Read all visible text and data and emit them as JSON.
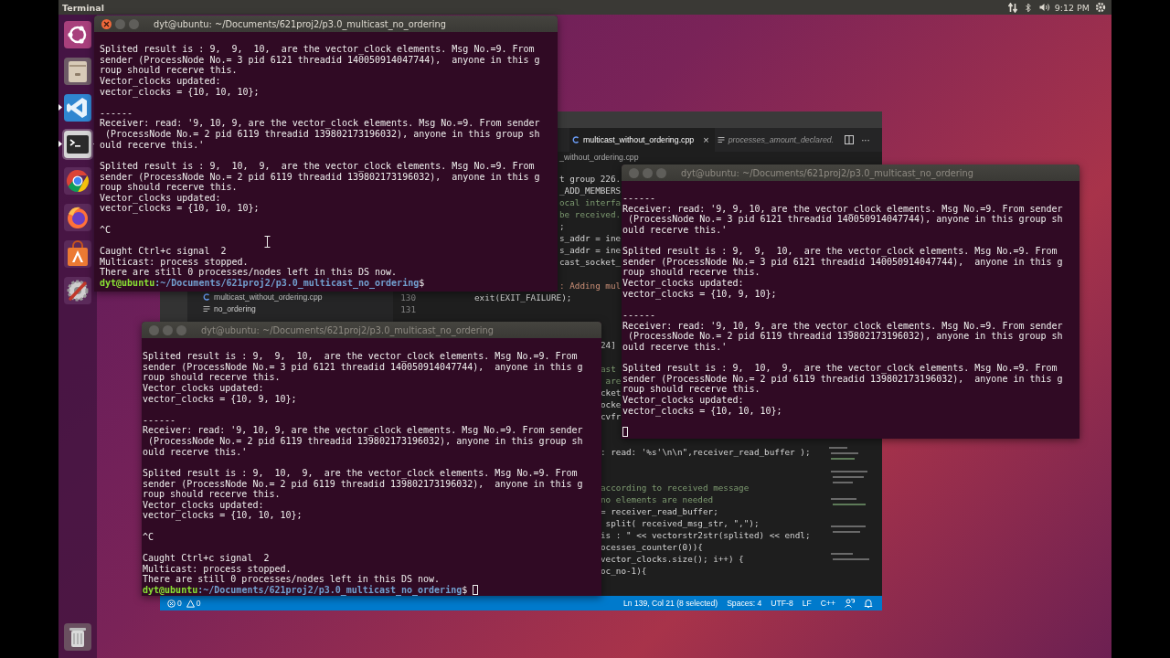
{
  "top_bar": {
    "app_name": "Terminal",
    "clock": "9:12 PM"
  },
  "launcher": [
    {
      "kind": "dash",
      "running": false,
      "active": false
    },
    {
      "kind": "files",
      "running": false,
      "active": false
    },
    {
      "kind": "code_editor",
      "running": true,
      "active": false
    },
    {
      "kind": "terminal",
      "running": true,
      "active": true
    },
    {
      "kind": "chrome",
      "running": false,
      "active": false
    },
    {
      "kind": "firefox",
      "running": false,
      "active": false
    },
    {
      "kind": "software",
      "running": false,
      "active": false
    },
    {
      "kind": "settings",
      "running": false,
      "active": false
    },
    {
      "kind": "trash",
      "running": false,
      "active": false
    }
  ],
  "editor_window": {
    "tabs": [
      {
        "label": "multicast_without_ordering.cpp",
        "kind": "cpp",
        "selected": true,
        "preview": false,
        "close": "×"
      },
      {
        "label": "processes_amount_declared.",
        "kind": "text",
        "selected": false,
        "preview": true
      }
    ],
    "more_actions": "···",
    "breadcrumb": "_without_ordering.cpp",
    "explorer": [
      {
        "label": "multicast_without_ordering.cpp",
        "kind": "cpp"
      },
      {
        "label": "no_ordering",
        "kind": "text"
      }
    ],
    "line_numbers": [
      "130",
      "131"
    ],
    "code_blocks": [
      {
        "lines": [
          {
            "text": "t group 226.",
            "kind": "code"
          },
          {
            "text": "_ADD_MEMBERS",
            "kind": "code"
          },
          {
            "text": "ocal interfa",
            "kind": "comment"
          },
          {
            "text": "be received.",
            "kind": "comment"
          },
          {
            "text": ";",
            "kind": "code"
          },
          {
            "text": "s_addr = ine",
            "kind": "code"
          },
          {
            "text": "s_addr = ine",
            "kind": "code"
          },
          {
            "text": "cast_socket_",
            "kind": "code"
          }
        ]
      },
      {
        "lines": [
          {
            "text": ": Adding mul",
            "kind": "string"
          }
        ]
      },
      {
        "lines": [
          {
            "text": "exit(EXIT_FAILURE);",
            "kind": "code"
          }
        ]
      },
      {
        "lines": [
          {
            "text": "24]",
            "kind": "code"
          }
        ]
      },
      {
        "lines": [
          {
            "text": "ast",
            "kind": "comment"
          },
          {
            "text": " are",
            "kind": "comment"
          },
          {
            "text": "cket",
            "kind": "code"
          },
          {
            "text": "ocke",
            "kind": "code"
          },
          {
            "text": "cvfr",
            "kind": "code"
          }
        ]
      },
      {
        "lines": [
          {
            "text": ": read: '%s'\\n\\n\",receiver_read_buffer );",
            "kind": "code"
          }
        ]
      },
      {
        "lines": [
          {
            "text": "according to received message",
            "kind": "comment"
          },
          {
            "text": "no elements are needed",
            "kind": "comment"
          },
          {
            "text": "= receiver_read_buffer;",
            "kind": "code"
          },
          {
            "text": " split( received_msg_str, \",\");",
            "kind": "code"
          },
          {
            "text": "is : \" << vectorstr2str(splited) << endl;",
            "kind": "code"
          },
          {
            "text": "ocesses_counter(0)){",
            "kind": "code"
          },
          {
            "text": "vector_clocks.size(); i++) {",
            "kind": "code"
          },
          {
            "text": "oc_no-1){",
            "kind": "code"
          }
        ]
      }
    ],
    "status": {
      "errors": "0",
      "warnings": "0",
      "items": [
        "Ln 139, Col 21 (8 selected)",
        "Spaces: 4",
        "UTF-8",
        "LF",
        "C++"
      ]
    }
  },
  "terminals": [
    {
      "title": "dyt@ubuntu: ~/Documents/621proj2/p3.0_multicast_no_ordering",
      "focused": true,
      "output": [
        [
          "Splited result is : 9,  9,  10,  are the vector_clock elements. Msg No.=9. From",
          "sender (ProcessNode No.= 3 pid 6121 threadid 140050914047744),  anyone in this g",
          "roup should recerve this.",
          "Vector_clocks updated:",
          "vector_clocks = {10, 10, 10};"
        ],
        [
          "------",
          "Receiver: read: '9, 10, 9, are the vector_clock elements. Msg No.=9. From sender",
          " (ProcessNode No.= 2 pid 6119 threadid 139802173196032), anyone in this group sh",
          "ould recerve this.'"
        ],
        [
          "Splited result is : 9,  10,  9,  are the vector_clock elements. Msg No.=9. From",
          "sender (ProcessNode No.= 2 pid 6119 threadid 139802173196032),  anyone in this g",
          "roup should recerve this.",
          "Vector_clocks updated:",
          "vector_clocks = {10, 10, 10};"
        ],
        [
          "^C"
        ],
        [
          "Caught Ctrl+c signal  2",
          "Multicast: process stopped.",
          "There are still 0 processes/nodes left in this DS now."
        ]
      ],
      "prompt": {
        "user": "dyt@ubuntu",
        "path": ":~/Documents/621proj2/p3.0_multicast_no_ordering",
        "symbol": "$"
      },
      "cursor": false
    },
    {
      "title": "dyt@ubuntu: ~/Documents/621proj2/p3.0_multicast_no_ordering",
      "focused": false,
      "output": [
        [
          "------",
          "Receiver: read: '9, 9, 10, are the vector_clock elements. Msg No.=9. From sender",
          " (ProcessNode No.= 3 pid 6121 threadid 140050914047744), anyone in this group sh",
          "ould recerve this.'"
        ],
        [
          "Splited result is : 9,  9,  10,  are the vector_clock elements. Msg No.=9. From",
          "sender (ProcessNode No.= 3 pid 6121 threadid 140050914047744),  anyone in this g",
          "roup should recerve this.",
          "Vector_clocks updated:",
          "vector_clocks = {10, 9, 10};"
        ],
        [
          "------",
          "Receiver: read: '9, 10, 9, are the vector_clock elements. Msg No.=9. From sender",
          " (ProcessNode No.= 2 pid 6119 threadid 139802173196032), anyone in this group sh",
          "ould recerve this.'"
        ],
        [
          "Splited result is : 9,  10,  9,  are the vector_clock elements. Msg No.=9. From",
          "sender (ProcessNode No.= 2 pid 6119 threadid 139802173196032),  anyone in this g",
          "roup should recerve this.",
          "Vector_clocks updated:",
          "vector_clocks = {10, 10, 10};"
        ]
      ],
      "cursor": true
    },
    {
      "title": "dyt@ubuntu: ~/Documents/621proj2/p3.0_multicast_no_ordering",
      "focused": false,
      "output": [
        [
          "Splited result is : 9,  9,  10,  are the vector_clock elements. Msg No.=9. From",
          "sender (ProcessNode No.= 3 pid 6121 threadid 140050914047744),  anyone in this g",
          "roup should recerve this.",
          "Vector_clocks updated:",
          "vector_clocks = {10, 9, 10};"
        ],
        [
          "------",
          "Receiver: read: '9, 10, 9, are the vector_clock elements. Msg No.=9. From sender",
          " (ProcessNode No.= 2 pid 6119 threadid 139802173196032), anyone in this group sh",
          "ould recerve this.'"
        ],
        [
          "Splited result is : 9,  10,  9,  are the vector_clock elements. Msg No.=9. From",
          "sender (ProcessNode No.= 2 pid 6119 threadid 139802173196032),  anyone in this g",
          "roup should recerve this.",
          "Vector_clocks updated:",
          "vector_clocks = {10, 10, 10};"
        ],
        [
          "^C"
        ],
        [
          "Caught Ctrl+c signal  2",
          "Multicast: process stopped.",
          "There are still 0 processes/nodes left in this DS now."
        ]
      ],
      "prompt": {
        "user": "dyt@ubuntu",
        "path": ":~/Documents/621proj2/p3.0_multicast_no_ordering",
        "symbol": "$"
      },
      "cursor": true
    }
  ]
}
